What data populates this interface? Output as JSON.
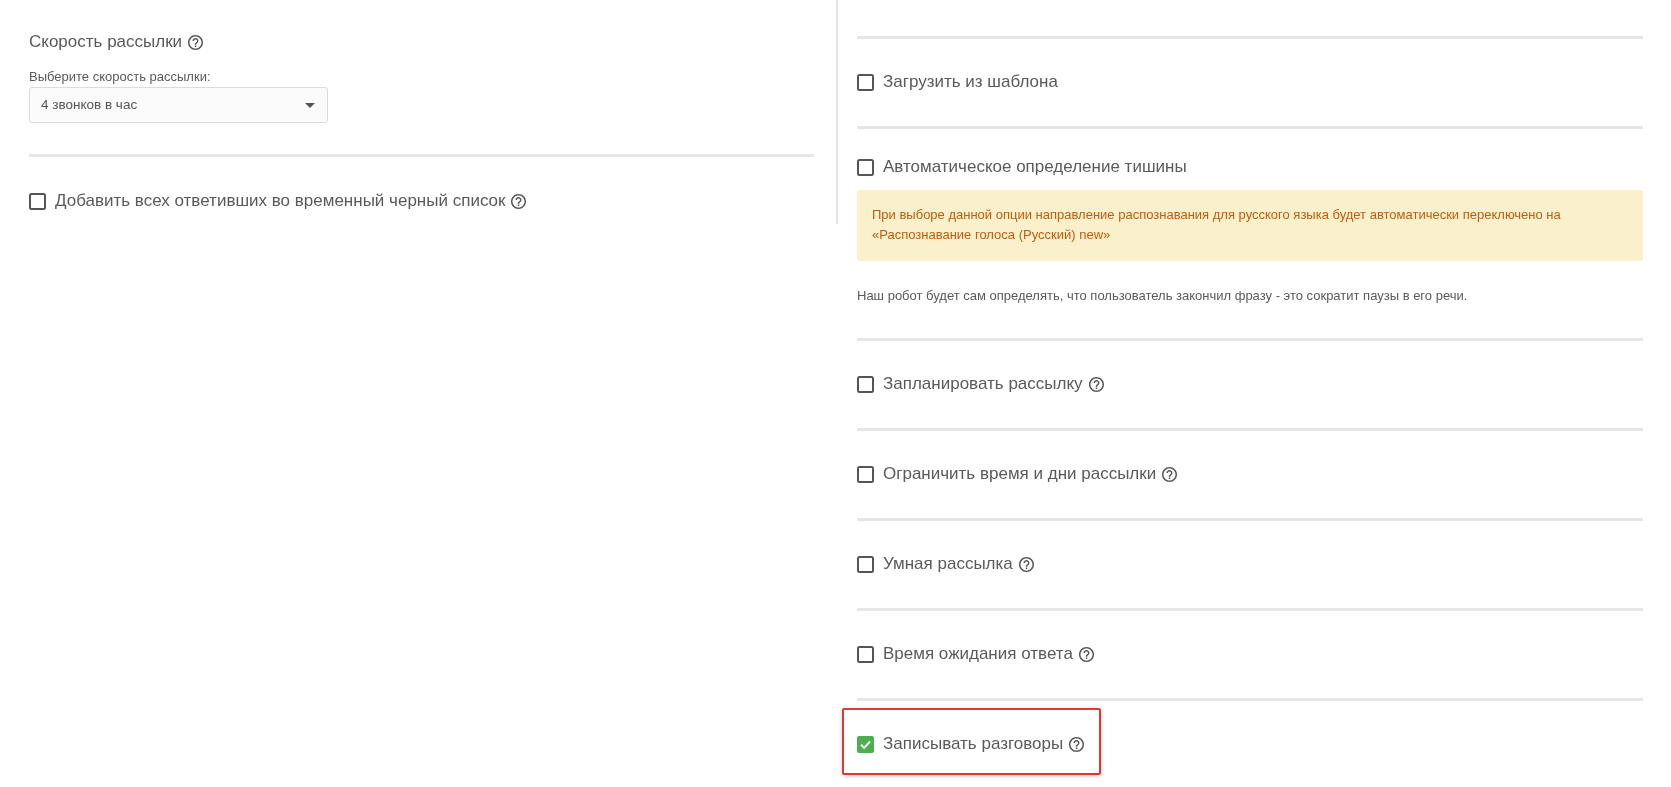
{
  "send_speed": {
    "title": "Скорость рассылки",
    "help": true,
    "label": "Выберите скорость рассылки:",
    "value": "4 звонков в час"
  },
  "left_options": [
    {
      "label": "Добавить всех ответивших во временный черный список",
      "checked": false,
      "help": true
    }
  ],
  "right_options": [
    {
      "label": "Загрузить из шаблона",
      "checked": false
    },
    {
      "label": "Автоматическое определение тишины",
      "checked": false,
      "notice": "При выборе данной опции направление распознавания для русского языка будет автоматически переключено на «Распознавание голоса (Русский) new»",
      "description": "Наш робот будет сам определять, что пользователь закончил фразу - это сократит паузы в его речи."
    },
    {
      "label": "Запланировать рассылку",
      "checked": false,
      "help": true
    },
    {
      "label": "Ограничить время и дни рассылки",
      "checked": false,
      "help": true
    },
    {
      "label": "Умная рассылка",
      "checked": false,
      "help": true
    },
    {
      "label": "Время ожидания ответа",
      "checked": false,
      "help": true
    },
    {
      "label": "Записывать разговоры",
      "checked": true,
      "help": true,
      "highlighted": true
    }
  ]
}
